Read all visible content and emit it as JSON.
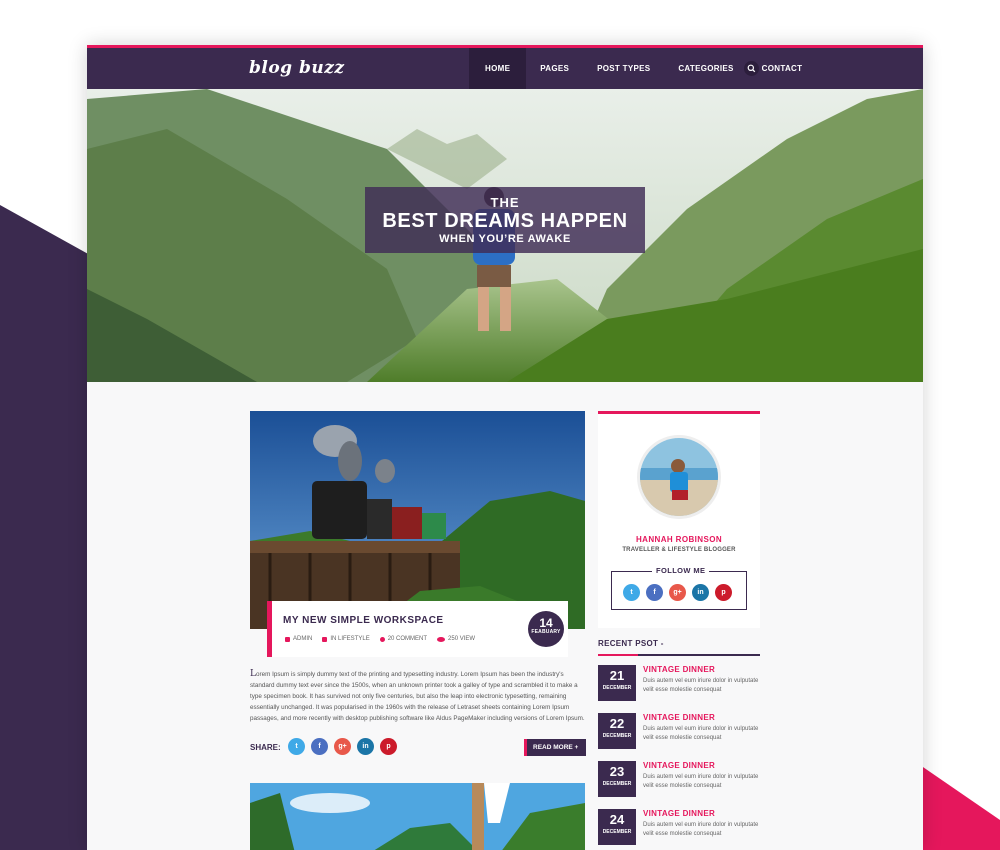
{
  "brand": {
    "logo": "blog buzz"
  },
  "nav": {
    "items": [
      "HOME",
      "PAGES",
      "POST TYPES",
      "CATEGORIES",
      "CONTACT"
    ],
    "active": "HOME",
    "search_icon": "search-icon"
  },
  "hero": {
    "line1": "THE",
    "line2": "BEST DREAMS HAPPEN",
    "line3": "WHEN YOU’RE AWAKE"
  },
  "post": {
    "title": "MY NEW SIMPLE WORKSPACE",
    "date_day": "14",
    "date_month": "FEABUARY",
    "meta": {
      "author": "ADMIN",
      "category": "IN LIFESTYLE",
      "comments": "20 COMMENT",
      "views": "250 VIEW"
    },
    "body_first": "L",
    "body_rest": "orem Ipsum is simply dummy text of the printing and typesetting industry. Lorem Ipsum has been the industry's standard dummy text ever since the 1500s, when an unknown printer took a galley of type and scrambled it to make a type specimen book. It has survived not only five centuries, but also the leap into electronic typesetting, remaining essentially unchanged. It was popularised in the 1960s with the release of Letraset sheets containing Lorem Ipsum passages, and more recently with desktop publishing software like Aldus PageMaker including versions of Lorem Ipsum.",
    "share_label": "SHARE:",
    "read_more": "READ MORE +"
  },
  "social": {
    "twitter": "t",
    "facebook": "f",
    "google": "g+",
    "linkedin": "in",
    "pinterest": "p"
  },
  "about": {
    "name": "HANNAH ROBINSON",
    "role": "TRAVELLER & LIFESTYLE BLOGGER",
    "follow_label": "FOLLOW ME"
  },
  "recent": {
    "title": "RECENT PSOT -",
    "items": [
      {
        "day": "21",
        "month": "DECEMBER",
        "title": "VINTAGE DINNER",
        "text": "Duis autem vel eum iriure dolor in vulputate velit esse molestie consequat"
      },
      {
        "day": "22",
        "month": "DECEMBER",
        "title": "VINTAGE DINNER",
        "text": "Duis autem vel eum iriure dolor in vulputate velit esse molestie consequat"
      },
      {
        "day": "23",
        "month": "DECEMBER",
        "title": "VINTAGE DINNER",
        "text": "Duis autem vel eum iriure dolor in vulputate velit esse molestie consequat"
      },
      {
        "day": "24",
        "month": "DECEMBER",
        "title": "VINTAGE DINNER",
        "text": "Duis autem vel eum iriure dolor in vulputate velit esse molestie consequat"
      }
    ]
  },
  "colors": {
    "primary": "#3b2a4f",
    "accent": "#e5175c",
    "twitter": "#3fa9e7",
    "facebook": "#4b6fc1",
    "google": "#e8584a",
    "linkedin": "#1b75a7",
    "pinterest": "#cc1b2b"
  }
}
